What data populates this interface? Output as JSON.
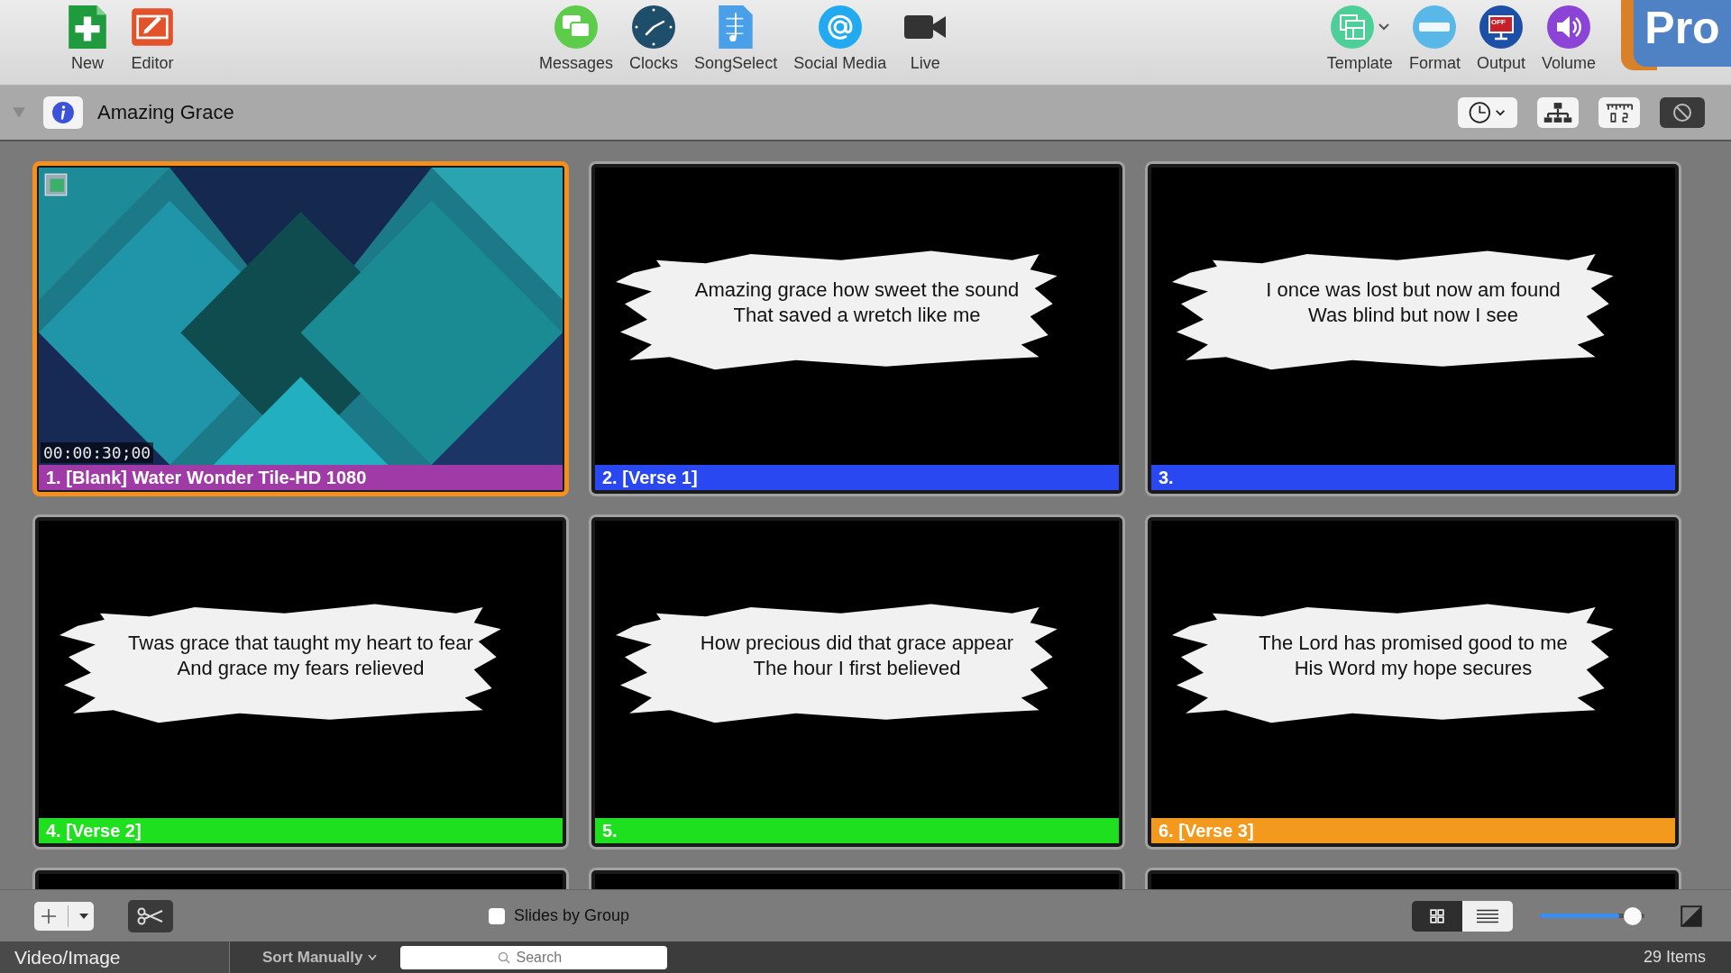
{
  "toolbar": {
    "left": [
      {
        "label": "New"
      },
      {
        "label": "Editor"
      }
    ],
    "center": [
      {
        "label": "Messages"
      },
      {
        "label": "Clocks"
      },
      {
        "label": "SongSelect"
      },
      {
        "label": "Social Media"
      },
      {
        "label": "Live"
      }
    ],
    "right": [
      {
        "label": "Template"
      },
      {
        "label": "Format"
      },
      {
        "label": "Output",
        "badge": "OFF"
      },
      {
        "label": "Volume"
      }
    ],
    "logo": "Pro"
  },
  "presentation": {
    "title": "Amazing Grace"
  },
  "slides": [
    {
      "kind": "media",
      "label": "1. [Blank] Water Wonder Tile-HD 1080",
      "timecode": "00:00:30;00",
      "color": "#a03aa6",
      "selected": true
    },
    {
      "kind": "text",
      "label": "2. [Verse 1]",
      "lines": [
        "Amazing grace how sweet the sound",
        "That saved a wretch like me"
      ],
      "color": "#2a48f2",
      "selected": false
    },
    {
      "kind": "text",
      "label": "3.",
      "lines": [
        "I once was lost but now am found",
        "Was blind but now I see"
      ],
      "color": "#2a48f2",
      "selected": false
    },
    {
      "kind": "text",
      "label": "4. [Verse 2]",
      "lines": [
        "Twas grace that taught my heart to fear",
        "And grace my fears relieved"
      ],
      "color": "#1fe01f",
      "selected": false
    },
    {
      "kind": "text",
      "label": "5.",
      "lines": [
        "How precious did that grace appear",
        "The hour I first believed"
      ],
      "color": "#1fe01f",
      "selected": false
    },
    {
      "kind": "text",
      "label": "6. [Verse 3]",
      "lines": [
        "The Lord has promised good to me",
        "His Word my hope secures"
      ],
      "color": "#f39a1e",
      "selected": false
    },
    {
      "kind": "cut",
      "selected": false
    },
    {
      "kind": "cut",
      "selected": false
    },
    {
      "kind": "cut",
      "selected": false
    }
  ],
  "bottom_bar": {
    "slides_by_group": {
      "label": "Slides by Group",
      "checked": false
    },
    "view_modes": [
      {
        "selected": true
      },
      {
        "selected": false
      }
    ],
    "zoom": {
      "level": 0.76
    }
  },
  "library": {
    "tab": "Video/Image",
    "sort": "Sort Manually",
    "search": {
      "placeholder": "Search"
    },
    "count": "29 Items"
  }
}
